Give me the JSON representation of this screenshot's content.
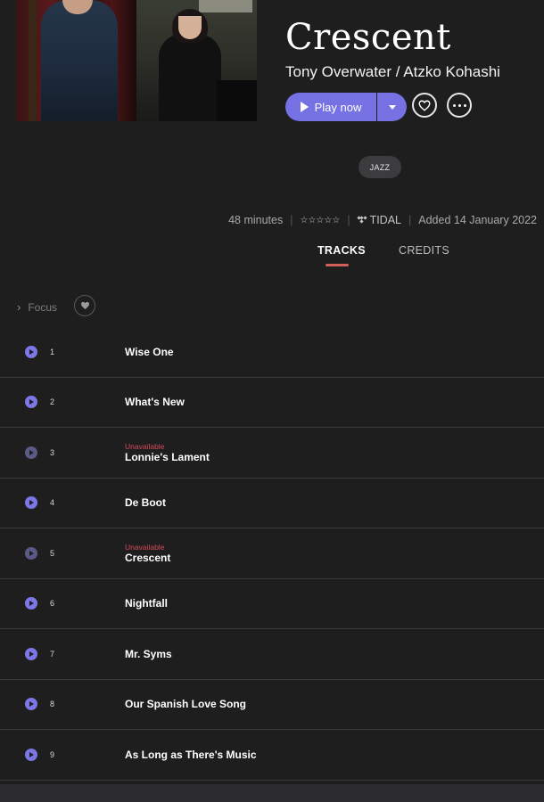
{
  "album": {
    "title": "Crescent",
    "artist": "Tony Overwater / Atzko Kohashi"
  },
  "actions": {
    "play_label": "Play now",
    "play_icon": "play-icon",
    "dropdown_icon": "caret-down-icon",
    "favorite_icon": "heart-icon",
    "more_icon": "more-icon"
  },
  "genre_tag": "JAZZ",
  "meta": {
    "duration": "48 minutes",
    "rating_stars": "☆☆☆☆☆",
    "source": "TIDAL",
    "added": "Added 14 January 2022"
  },
  "tabs": [
    {
      "label": "TRACKS",
      "active": true
    },
    {
      "label": "CREDITS",
      "active": false
    }
  ],
  "focus": {
    "label": "Focus"
  },
  "colors": {
    "accent": "#7672e3",
    "background": "#1e1e1f",
    "unavailable": "#d44a5a",
    "tab_underline": "#d2605a"
  },
  "tracks": [
    {
      "number": "1",
      "title": "Wise One",
      "status": ""
    },
    {
      "number": "2",
      "title": "What's New",
      "status": ""
    },
    {
      "number": "3",
      "title": "Lonnie's Lament",
      "status": "Unavailable"
    },
    {
      "number": "4",
      "title": "De Boot",
      "status": ""
    },
    {
      "number": "5",
      "title": "Crescent",
      "status": "Unavailable"
    },
    {
      "number": "6",
      "title": "Nightfall",
      "status": ""
    },
    {
      "number": "7",
      "title": "Mr. Syms",
      "status": ""
    },
    {
      "number": "8",
      "title": "Our Spanish Love Song",
      "status": ""
    },
    {
      "number": "9",
      "title": "As Long as There's Music",
      "status": ""
    }
  ]
}
